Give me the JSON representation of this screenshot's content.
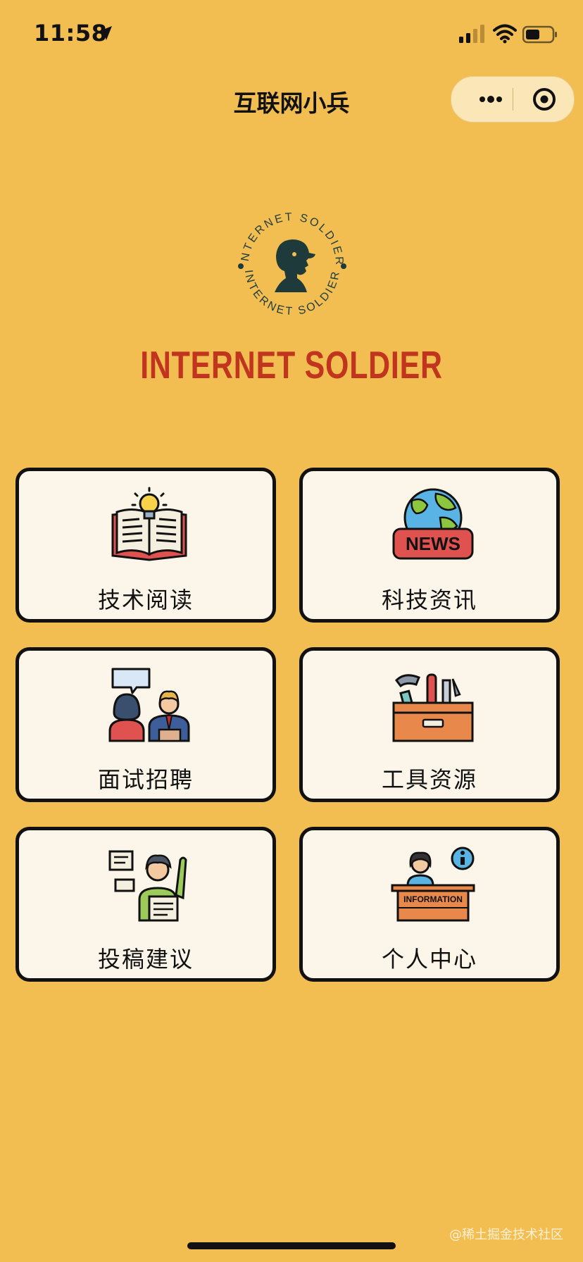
{
  "status_bar": {
    "time": "11:58"
  },
  "nav": {
    "title": "互联网小兵"
  },
  "logo": {
    "ring_text": "INTERNET SOLDIER",
    "brand": "INTERNET SOLDIER",
    "brand_color": "#C1351E"
  },
  "menu": [
    {
      "label": "技术阅读",
      "icon": "book-lightbulb-icon"
    },
    {
      "label": "科技资讯",
      "icon": "news-globe-icon"
    },
    {
      "label": "面试招聘",
      "icon": "interview-people-icon"
    },
    {
      "label": "工具资源",
      "icon": "toolbox-icon"
    },
    {
      "label": "投稿建议",
      "icon": "submit-suggestion-icon"
    },
    {
      "label": "个人中心",
      "icon": "information-desk-icon"
    }
  ],
  "icon_texts": {
    "news": "NEWS",
    "information": "INFORMATION"
  },
  "watermark": "@稀土掘金技术社区",
  "colors": {
    "background": "#F2BE52",
    "card": "#FCF6EA",
    "border": "#111111"
  }
}
